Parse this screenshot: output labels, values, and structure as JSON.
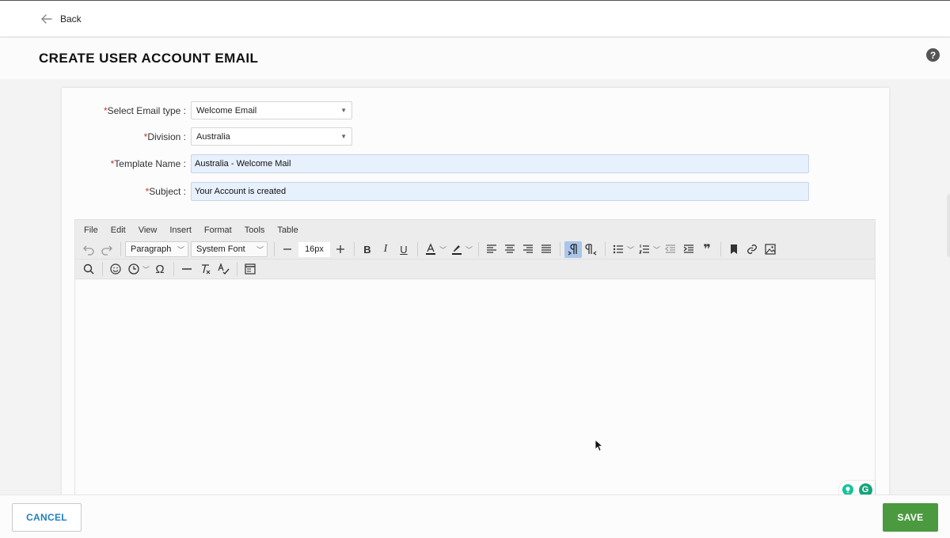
{
  "topbar": {
    "back_label": "Back"
  },
  "header": {
    "title": "CREATE USER ACCOUNT EMAIL",
    "help_glyph": "?"
  },
  "form": {
    "email_type": {
      "required_mark": "*",
      "label": "Select Email type :",
      "value": "Welcome Email"
    },
    "division": {
      "required_mark": "*",
      "label": "Division :",
      "value": "Australia"
    },
    "template_name": {
      "required_mark": "*",
      "label": "Template Name :",
      "value": "Australia - Welcome Mail"
    },
    "subject": {
      "required_mark": "*",
      "label": "Subject :",
      "value": "Your Account is created"
    }
  },
  "editor": {
    "menu": [
      "File",
      "Edit",
      "View",
      "Insert",
      "Format",
      "Tools",
      "Table"
    ],
    "block_format": "Paragraph",
    "font_family": "System Font",
    "font_size": "16px",
    "icons": {
      "undo": "undo-icon",
      "redo": "redo-icon",
      "bold": "B",
      "italic": "I",
      "underline": "U",
      "omega": "Ω",
      "quote": "❞"
    }
  },
  "grammarly": {
    "badge": "G"
  },
  "footer": {
    "cancel_label": "CANCEL",
    "save_label": "SAVE"
  },
  "colors": {
    "save_green": "#4b9a3f",
    "cancel_blue": "#1f7fc2",
    "input_fill": "#e7f0fd",
    "active_tool": "#a9c6ea"
  }
}
